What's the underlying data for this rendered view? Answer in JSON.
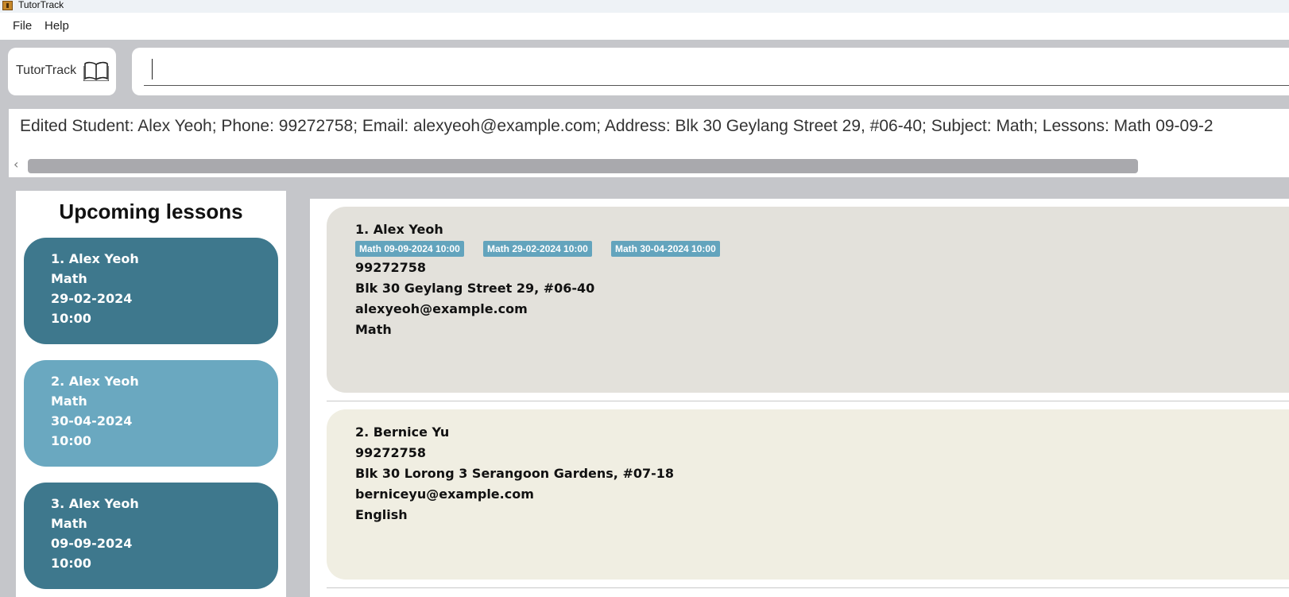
{
  "window": {
    "title": "TutorTrack"
  },
  "menu": {
    "file": "File",
    "help": "Help"
  },
  "logo": {
    "text": "TutorTrack"
  },
  "command": {
    "value": "",
    "placeholder": ""
  },
  "result": {
    "text": "Edited Student: Alex Yeoh; Phone: 99272758; Email: alexyeoh@example.com; Address: Blk 30 Geylang Street 29, #06-40; Subject: Math; Lessons: Math  09-09-2"
  },
  "upcoming": {
    "title": "Upcoming lessons",
    "lessons": [
      {
        "name": "1.  Alex Yeoh",
        "subject": "Math",
        "date": "29-02-2024",
        "time": "10:00"
      },
      {
        "name": "2.  Alex Yeoh",
        "subject": "Math",
        "date": "30-04-2024",
        "time": "10:00"
      },
      {
        "name": "3.  Alex Yeoh",
        "subject": "Math",
        "date": "09-09-2024",
        "time": "10:00"
      }
    ]
  },
  "students": [
    {
      "name": "1.  Alex Yeoh",
      "lessons": [
        "Math  09-09-2024  10:00",
        "Math  29-02-2024  10:00",
        "Math  30-04-2024  10:00"
      ],
      "phone": "99272758",
      "address": "Blk 30 Geylang Street 29, #06-40",
      "email": "alexyeoh@example.com",
      "subject": "Math"
    },
    {
      "name": "2.  Bernice Yu",
      "lessons": [],
      "phone": "99272758",
      "address": "Blk 30 Lorong 3 Serangoon Gardens, #07-18",
      "email": "berniceyu@example.com",
      "subject": "English"
    }
  ]
}
